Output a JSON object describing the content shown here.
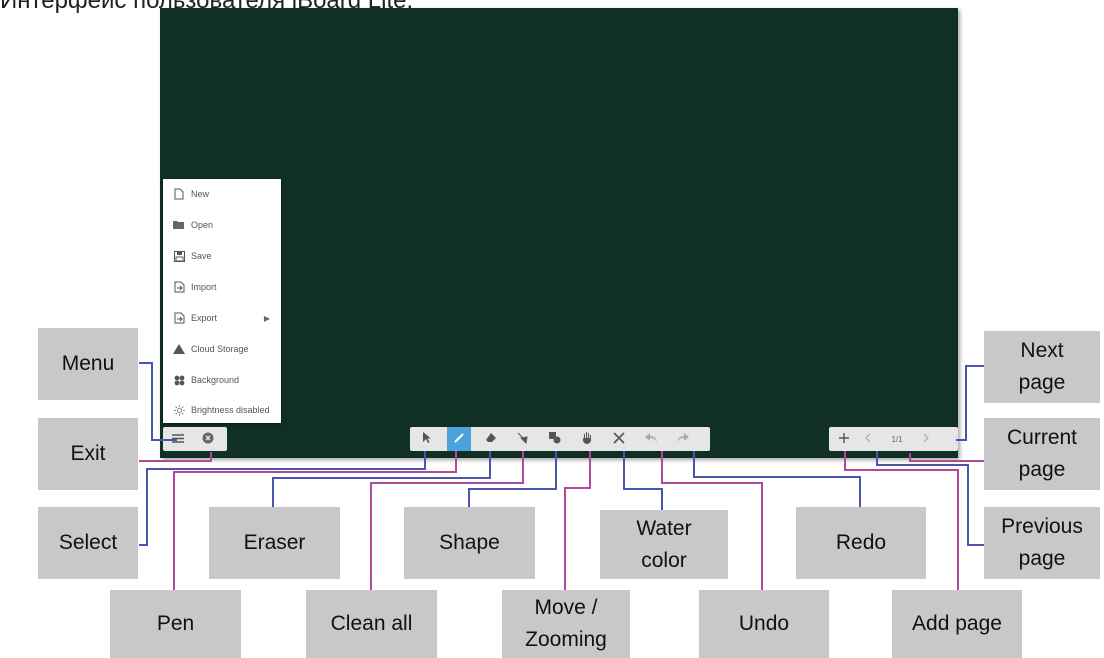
{
  "title": "Интерфейс пользователя iBoard Lite.",
  "menu": {
    "items": [
      {
        "label": "New",
        "icon": "new-file-icon"
      },
      {
        "label": "Open",
        "icon": "folder-open-icon"
      },
      {
        "label": "Save",
        "icon": "save-icon"
      },
      {
        "label": "Import",
        "icon": "import-icon"
      },
      {
        "label": "Export",
        "icon": "export-icon",
        "submenu_arrow": "▶"
      },
      {
        "label": "Cloud Storage",
        "icon": "cloud-storage-icon"
      },
      {
        "label": "Background",
        "icon": "background-icon"
      },
      {
        "label": "Brightness disabled",
        "icon": "brightness-icon"
      }
    ]
  },
  "toolbar": {
    "page_indicator": "1/1",
    "active_tool": "pen"
  },
  "callouts": {
    "menu": "Menu",
    "exit": "Exit",
    "select": "Select",
    "pen": "Pen",
    "eraser": "Eraser",
    "clean_all": "Clean all",
    "shape": "Shape",
    "move_zooming": "Move / Zooming",
    "water_color": "Water color",
    "undo": "Undo",
    "redo": "Redo",
    "add_page": "Add page",
    "next_page": "Next page",
    "current_page": "Current page",
    "previous_page": "Previous page"
  },
  "colors": {
    "board": "#102f25",
    "callout_box": "#c8c8c8",
    "blue_line": "#4a55b0",
    "purple_line": "#b0489e",
    "active_tool": "#4aa3dc"
  }
}
